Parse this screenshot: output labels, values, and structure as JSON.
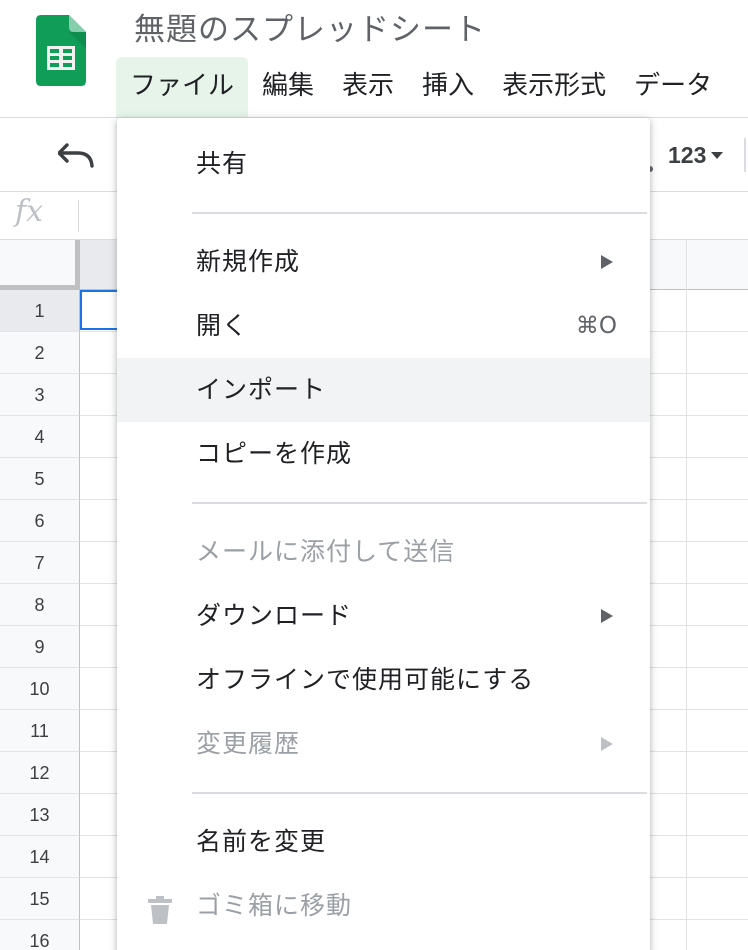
{
  "app": {
    "doc_title": "無題のスプレッドシート"
  },
  "menubar": {
    "items": [
      "ファイル",
      "編集",
      "表示",
      "挿入",
      "表示形式",
      "データ"
    ],
    "active_index": 0
  },
  "toolbar": {
    "format_label": "123"
  },
  "formula_bar": {
    "fx_label": "fx"
  },
  "grid": {
    "row_numbers": [
      "1",
      "2",
      "3",
      "4",
      "5",
      "6",
      "7",
      "8",
      "9",
      "10",
      "11",
      "12",
      "13",
      "14",
      "15",
      "16"
    ],
    "selected_cell": "A1"
  },
  "file_menu": {
    "share": {
      "label": "共有"
    },
    "new": {
      "label": "新規作成",
      "has_submenu": true
    },
    "open": {
      "label": "開く",
      "shortcut": "⌘O"
    },
    "import": {
      "label": "インポート",
      "hovered": true
    },
    "make_copy": {
      "label": "コピーを作成"
    },
    "email_attachment": {
      "label": "メールに添付して送信",
      "disabled": true
    },
    "download": {
      "label": "ダウンロード",
      "has_submenu": true
    },
    "offline": {
      "label": "オフラインで使用可能にする"
    },
    "version_history": {
      "label": "変更履歴",
      "has_submenu": true,
      "disabled": true
    },
    "rename": {
      "label": "名前を変更"
    },
    "move_to_trash": {
      "label": "ゴミ箱に移動",
      "disabled": true,
      "icon": "trash-icon"
    }
  },
  "colors": {
    "brand_green": "#0f9d58",
    "active_menu_bg": "#e6f4ea",
    "selection_blue": "#1a73e8",
    "hover_bg": "#f1f3f4",
    "disabled_text": "#9aa0a6"
  }
}
